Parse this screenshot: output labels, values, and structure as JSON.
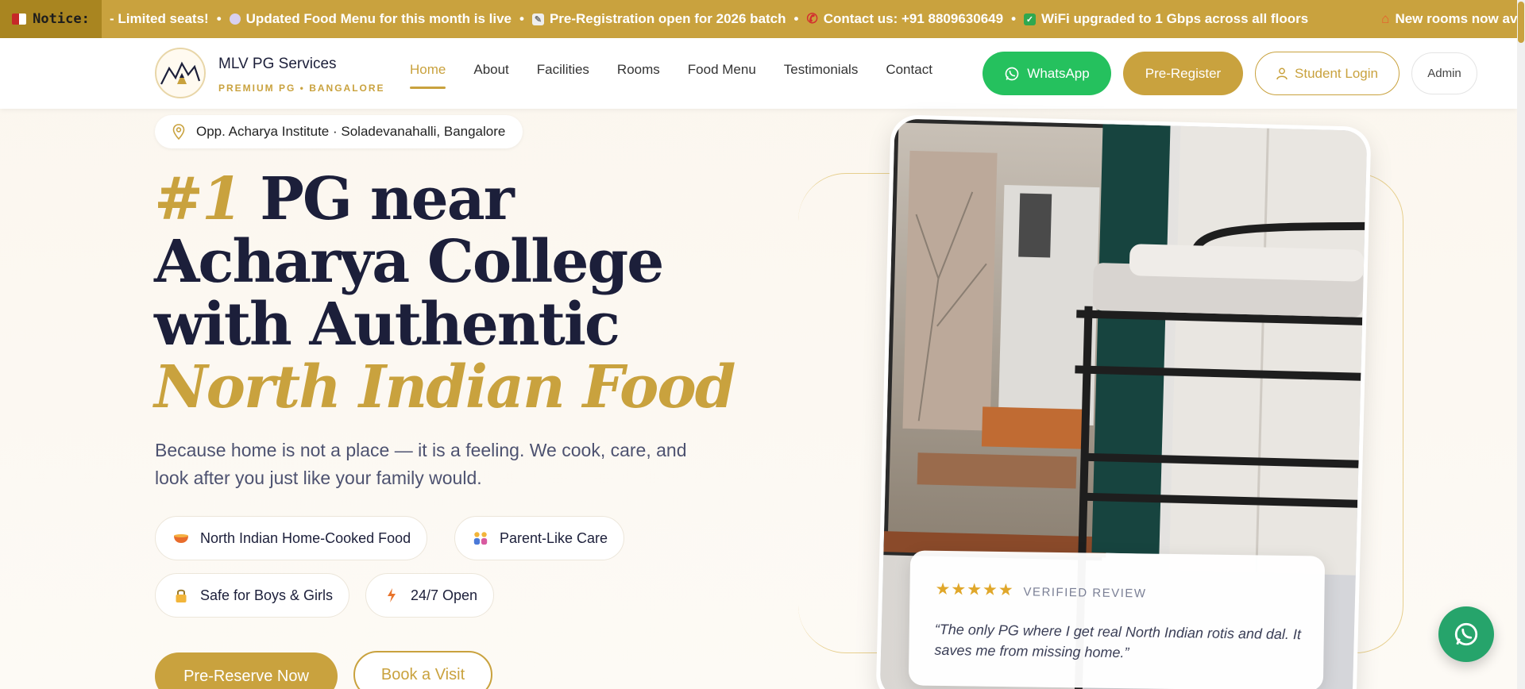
{
  "ticker": {
    "notice_label": "Notice:",
    "items": [
      "- Limited seats!",
      "Updated Food Menu for this month is live",
      "Pre-Registration open for 2026 batch",
      "Contact us: +91 8809630649",
      "WiFi upgraded to 1 Gbps across all floors",
      "New rooms now available – Li"
    ],
    "separator": "•"
  },
  "brand": {
    "name": "MLV PG Services",
    "tagline": "PREMIUM PG • BANGALORE"
  },
  "nav": {
    "items": [
      "Home",
      "About",
      "Facilities",
      "Rooms",
      "Food Menu",
      "Testimonials",
      "Contact"
    ],
    "active": "Home"
  },
  "header_actions": {
    "whatsapp": "WhatsApp",
    "preregister": "Pre-Register",
    "student_login": "Student Login",
    "admin": "Admin"
  },
  "hero": {
    "location": "Opp. Acharya Institute · Soladevanahalli, Bangalore",
    "title_rank": "#1",
    "title_part1": "PG near Acharya College",
    "title_part2": "with Authentic",
    "title_highlight": "North Indian Food",
    "lead": "Because home is not a place — it is a feeling. We cook, care, and look after you just like your family would.",
    "chips": [
      "North Indian Home-Cooked Food",
      "Parent-Like Care",
      "Safe for Boys & Girls",
      "24/7 Open"
    ],
    "cta_primary": "Pre-Reserve Now",
    "cta_secondary": "Book a Visit"
  },
  "review": {
    "stars": "★★★★★",
    "tag": "VERIFIED REVIEW",
    "text": "“The only PG where I get real North Indian rotis and dal. It saves me from missing home.”"
  },
  "colors": {
    "gold": "#c9a23e",
    "navy": "#1c1f3a",
    "whatsapp_green": "#25c15e"
  }
}
